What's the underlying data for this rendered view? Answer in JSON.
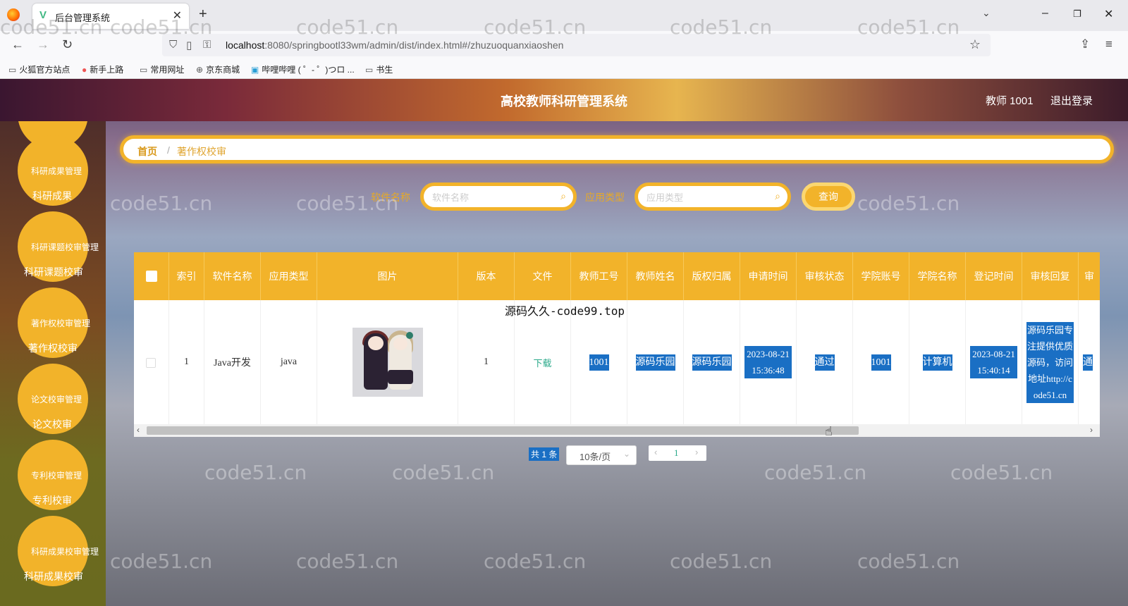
{
  "browser": {
    "tab_title": "后台管理系统",
    "url_host": "localhost",
    "url_rest": ":8080/springbootl33wm/admin/dist/index.html#/zhuzuoquanxiaoshen",
    "bookmarks": [
      "火狐官方站点",
      "新手上路",
      "常用网址",
      "京东商城",
      "哔哩哔哩 ( ゜- ゜)つロ ...",
      "书生"
    ]
  },
  "header": {
    "title": "高校教师科研管理系统",
    "user": "教师 1001",
    "logout": "退出登录"
  },
  "sidebar": {
    "items": [
      {
        "top": "科研成果管理",
        "sub": "科研成果"
      },
      {
        "top": "科研课题校审管理",
        "sub": "科研课题校审"
      },
      {
        "top": "著作权校审管理",
        "sub": "著作权校审"
      },
      {
        "top": "论文校审管理",
        "sub": "论文校审"
      },
      {
        "top": "专利校审管理",
        "sub": "专利校审"
      },
      {
        "top": "科研成果校审管理",
        "sub": "科研成果校审"
      }
    ]
  },
  "breadcrumb": {
    "home": "首页",
    "sep": "/",
    "current": "著作权校审"
  },
  "search": {
    "label1": "软件名称",
    "placeholder1": "软件名称",
    "label2": "应用类型",
    "placeholder2": "应用类型",
    "button": "查询"
  },
  "table": {
    "headers": [
      "索引",
      "软件名称",
      "应用类型",
      "图片",
      "版本",
      "文件",
      "教师工号",
      "教师姓名",
      "版权归属",
      "申请时间",
      "审核状态",
      "学院账号",
      "学院名称",
      "登记时间",
      "审核回复",
      "审"
    ],
    "row": {
      "index": "1",
      "name": "Java开发",
      "type": "java",
      "version": "1",
      "file": "下载",
      "teacher_no": "1001",
      "teacher_name": "源码乐园",
      "copyright": "源码乐园",
      "apply_time": "2023-08-21 15:36:48",
      "status": "通过",
      "college_no": "1001",
      "college_name": "计算机",
      "register_time": "2023-08-21 15:40:14",
      "reply": "源码乐园专注提供优质源码，访问地址http://code51.cn",
      "last": "通"
    }
  },
  "overlay_text": "源码久久-code99.top",
  "pagination": {
    "total": "共 1 条",
    "page_size": "10条/页",
    "current": "1"
  },
  "watermark": "code51.cn"
}
